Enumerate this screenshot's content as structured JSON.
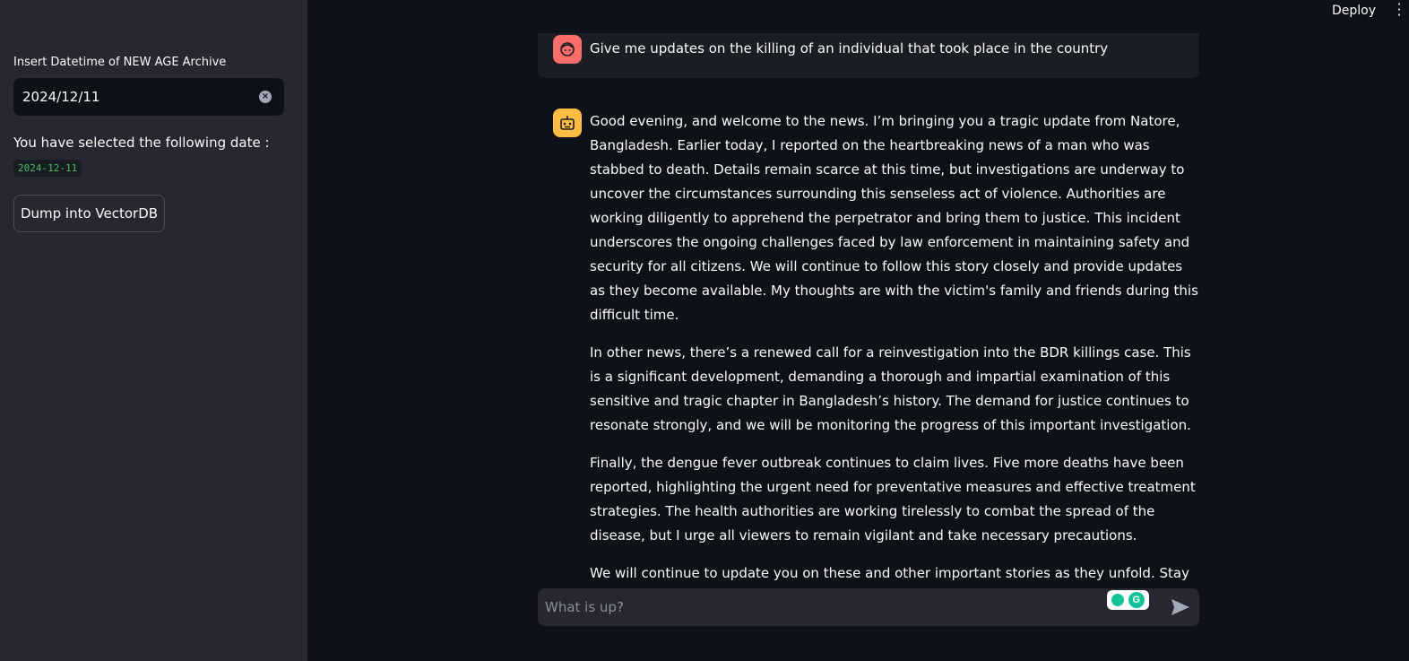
{
  "header": {
    "deploy_label": "Deploy"
  },
  "sidebar": {
    "date_label": "Insert Datetime of NEW AGE Archive",
    "date_value": "2024/12/11",
    "selected_text": "You have selected the following date :",
    "selected_date": "2024-12-11",
    "dump_button": "Dump into VectorDB"
  },
  "chat": {
    "user_message": "Give me updates on the killing of an individual that took place in the country",
    "assistant_paragraphs": [
      "Good evening, and welcome to the news. I’m bringing you a tragic update from Natore, Bangladesh. Earlier today, I reported on the heartbreaking news of a man who was stabbed to death. Details remain scarce at this time, but investigations are underway to uncover the circumstances surrounding this senseless act of violence. Authorities are working diligently to apprehend the perpetrator and bring them to justice. This incident underscores the ongoing challenges faced by law enforcement in maintaining safety and security for all citizens. We will continue to follow this story closely and provide updates as they become available. My thoughts are with the victim's family and friends during this difficult time.",
      "In other news, there’s a renewed call for a reinvestigation into the BDR killings case. This is a significant development, demanding a thorough and impartial examination of this sensitive and tragic chapter in Bangladesh’s history. The demand for justice continues to resonate strongly, and we will be monitoring the progress of this important investigation.",
      "Finally, the dengue fever outbreak continues to claim lives. Five more deaths have been reported, highlighting the urgent need for preventative measures and effective treatment strategies. The health authorities are working tirelessly to combat the spread of the disease, but I urge all viewers to remain vigilant and take necessary precautions.",
      "We will continue to update you on these and other important stories as they unfold. Stay tuned."
    ],
    "input_placeholder": "What is up?"
  },
  "colors": {
    "sidebar_bg": "#262730",
    "main_bg": "#0e1117",
    "user_avatar": "#ff6c6c",
    "bot_avatar": "#ffbd45",
    "code_green": "#4cbb5f"
  },
  "icons": [
    "clear-icon",
    "user-avatar-icon",
    "bot-avatar-icon",
    "send-icon",
    "menu-dots-icon",
    "grammarly-icon"
  ]
}
